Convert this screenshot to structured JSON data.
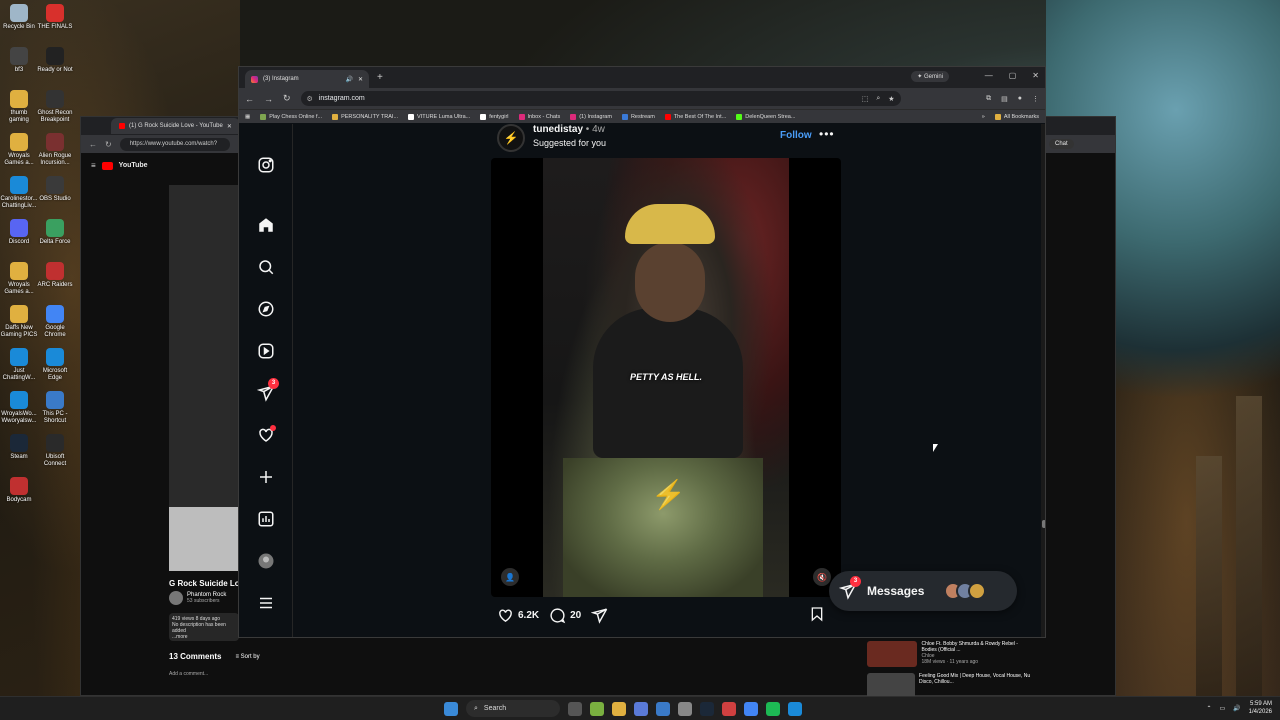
{
  "desktop": {
    "icons": [
      {
        "label": "Recycle Bin",
        "color": "#9fb6c8"
      },
      {
        "label": "THE FINALS",
        "color": "#d8302c"
      },
      {
        "label": "bf3",
        "color": "#444444"
      },
      {
        "label": "Ready or Not",
        "color": "#222222"
      },
      {
        "label": "thumb gaming",
        "color": "#e0b040"
      },
      {
        "label": "Ghost Recon Breakpoint",
        "color": "#333333"
      },
      {
        "label": "Wroyals Games a...",
        "color": "#e0b040"
      },
      {
        "label": "Alien Rogue Incursion...",
        "color": "#7a3030"
      },
      {
        "label": "Carolinestor... ChattingLiv...",
        "color": "#1a8ad8"
      },
      {
        "label": "OBS Studio",
        "color": "#3a3a3a"
      },
      {
        "label": "Discord",
        "color": "#5865f2"
      },
      {
        "label": "Delta Force",
        "color": "#3aa060"
      },
      {
        "label": "Wroyals Games a...",
        "color": "#e0b040"
      },
      {
        "label": "ARC Raiders",
        "color": "#c03030"
      },
      {
        "label": "Daffs New Gaming PICS",
        "color": "#e0b040"
      },
      {
        "label": "Google Chrome",
        "color": "#4285f4"
      },
      {
        "label": "Just ChattingW...",
        "color": "#1a8ad8"
      },
      {
        "label": "Microsoft Edge",
        "color": "#1a8ad8"
      },
      {
        "label": "WroyalsWo... Wworyalsw...",
        "color": "#1a8ad8"
      },
      {
        "label": "This PC - Shortcut",
        "color": "#3a7ac8"
      },
      {
        "label": "Steam",
        "color": "#1b2838"
      },
      {
        "label": "Ubisoft Connect",
        "color": "#2a2a2a"
      },
      {
        "label": "Bodycam",
        "color": "#c03030"
      }
    ]
  },
  "youtube_window": {
    "tab_title": "(1) G Rock Suicide Love - YouTube",
    "url": "https://www.youtube.com/watch?",
    "logo_text": "YouTube",
    "video_title": "G Rock Suicide Love",
    "channel_name": "Phantom Rock",
    "subscribers": "53 subscribers",
    "description": "419 views  8 days ago",
    "description_sub": "No description has been added",
    "more": "...more",
    "comments_count": "13 Comments",
    "sort_by": "Sort by",
    "add_comment": "Add a comment...",
    "chat_label": "Chat",
    "recommendations": [
      {
        "title": "Chloe Ft. Bobby Shmurda & Rowdy Rebel - Bodies (Official ...",
        "channel": "Chloe",
        "meta": "18M views · 11 years ago",
        "color": "#6a2a20"
      },
      {
        "title": "Feeling Good Mix | Deep House, Vocal House, Nu Disco, Chillou...",
        "channel": "",
        "meta": "",
        "color": "#444444"
      }
    ]
  },
  "chrome": {
    "tab_title": "(3) Instagram",
    "gemini_label": "Gemini",
    "url": "instagram.com",
    "bookmarks": [
      {
        "label": "Play Chess Online f...",
        "color": "#7fa650"
      },
      {
        "label": "PERSONALITY TRAI...",
        "color": "#e0b040"
      },
      {
        "label": "VITURE Luma Ultra...",
        "color": "#ffffff"
      },
      {
        "label": "fentygirl",
        "color": "#ffffff"
      },
      {
        "label": "Inbox - Chats",
        "color": "#dd2a7b"
      },
      {
        "label": "(1) Instagram",
        "color": "#dd2a7b"
      },
      {
        "label": "Restream",
        "color": "#3a7ad8"
      },
      {
        "label": "The Best Of The Int...",
        "color": "#ff0000"
      },
      {
        "label": "DelenQueen Strea...",
        "color": "#53fc18"
      }
    ],
    "all_bookmarks": "All Bookmarks"
  },
  "instagram": {
    "post": {
      "username": "tunedistay",
      "time": " • 4w",
      "suggested": "Suggested for you",
      "follow": "Follow",
      "more": "•••",
      "caption_overlay": "PETTY AS HELL.",
      "likes": "6.2K",
      "comments": "20"
    },
    "notification_badge": "3",
    "messages": {
      "label": "Messages",
      "badge": "3",
      "avatars": [
        "#c08060",
        "#7080a0",
        "#d0a040"
      ]
    }
  },
  "taskbar": {
    "search_label": "Search",
    "time": "5:59 AM",
    "date": "1/4/2026"
  }
}
